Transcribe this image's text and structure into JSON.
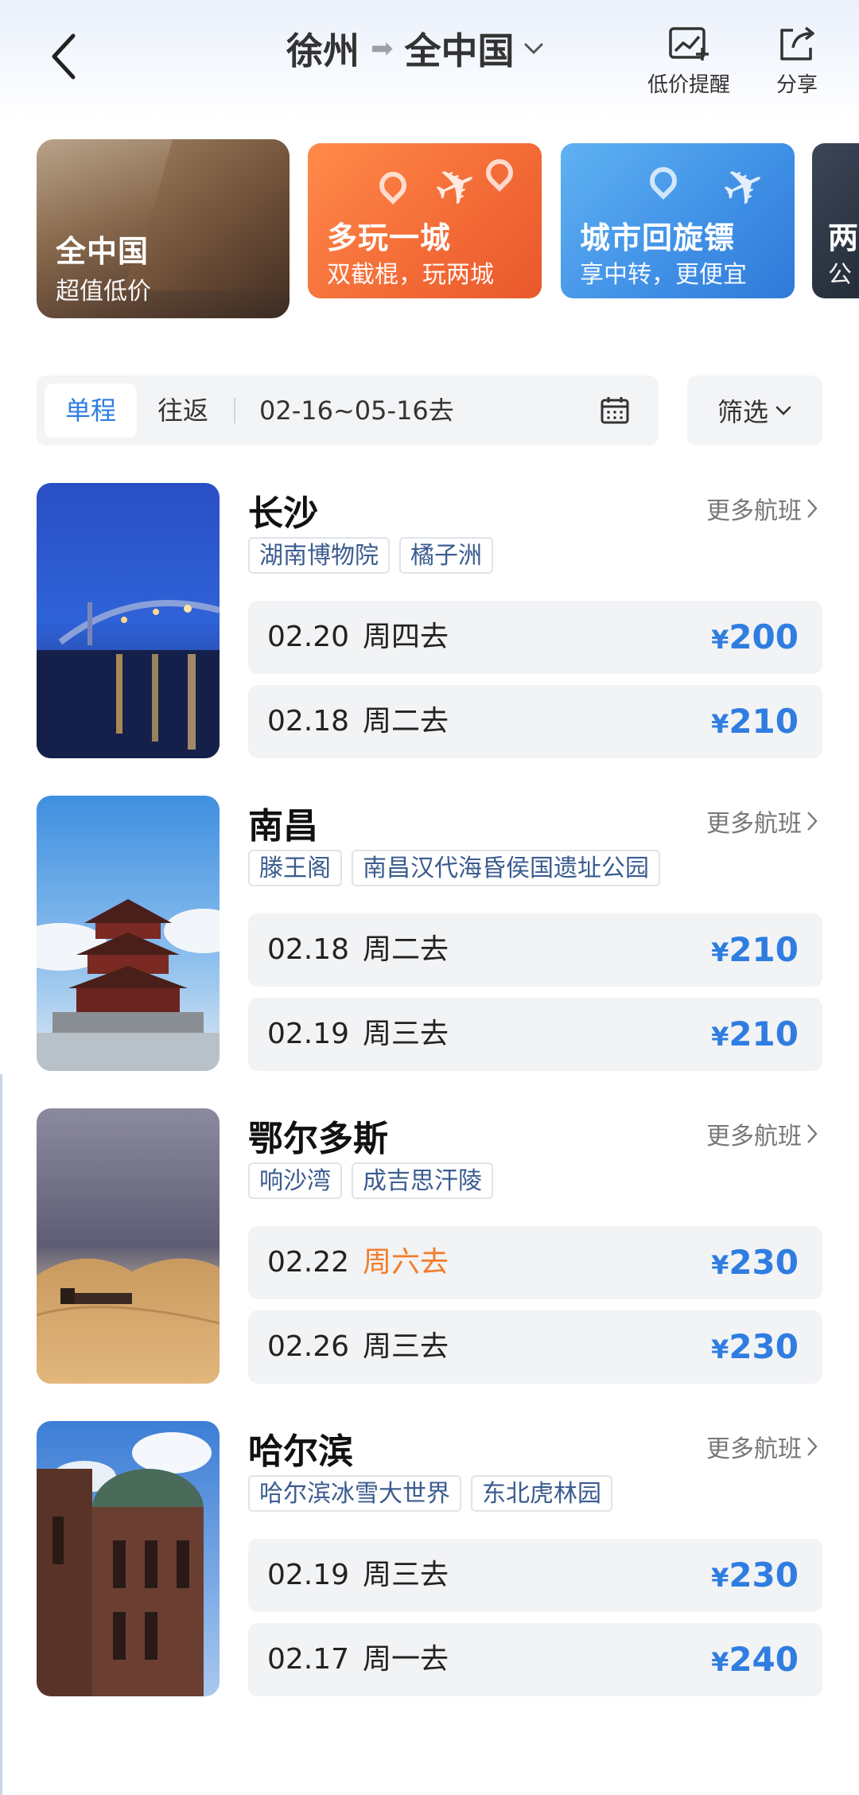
{
  "header": {
    "origin": "徐州",
    "arrow": "➡",
    "destination": "全中国",
    "actions": [
      {
        "label": "低价提醒",
        "icon": "price-alert-icon"
      },
      {
        "label": "分享",
        "icon": "share-icon"
      }
    ]
  },
  "banners": [
    {
      "title": "全中国",
      "subtitle": "超值低价"
    },
    {
      "title": "多玩一城",
      "subtitle": "双截棍，玩两城"
    },
    {
      "title": "城市回旋镖",
      "subtitle": "享中转，更便宜"
    },
    {
      "title": "两",
      "subtitle": "公"
    }
  ],
  "filter": {
    "tabs": [
      "单程",
      "往返"
    ],
    "active_tab": "单程",
    "date_range": "02-16~05-16去",
    "filter_label": "筛选"
  },
  "more_label": "更多航班",
  "destinations": [
    {
      "city": "长沙",
      "tags": [
        "湖南博物院",
        "橘子洲"
      ],
      "flights": [
        {
          "date": "02.20",
          "day": "周四去",
          "currency": "¥",
          "price": "200"
        },
        {
          "date": "02.18",
          "day": "周二去",
          "currency": "¥",
          "price": "210"
        }
      ]
    },
    {
      "city": "南昌",
      "tags": [
        "滕王阁",
        "南昌汉代海昏侯国遗址公园"
      ],
      "flights": [
        {
          "date": "02.18",
          "day": "周二去",
          "currency": "¥",
          "price": "210"
        },
        {
          "date": "02.19",
          "day": "周三去",
          "currency": "¥",
          "price": "210"
        }
      ]
    },
    {
      "city": "鄂尔多斯",
      "tags": [
        "响沙湾",
        "成吉思汗陵"
      ],
      "flights": [
        {
          "date": "02.22",
          "day": "周六去",
          "currency": "¥",
          "price": "230"
        },
        {
          "date": "02.26",
          "day": "周三去",
          "currency": "¥",
          "price": "230"
        }
      ]
    },
    {
      "city": "哈尔滨",
      "tags": [
        "哈尔滨冰雪大世界",
        "东北虎林园"
      ],
      "flights": [
        {
          "date": "02.19",
          "day": "周三去",
          "currency": "¥",
          "price": "230"
        },
        {
          "date": "02.17",
          "day": "周一去",
          "currency": "¥",
          "price": "240"
        }
      ]
    }
  ],
  "colors": {
    "accent_blue": "#2f7de1",
    "weekend_orange": "#f37c2a",
    "tag_text": "#3b5c8f"
  }
}
